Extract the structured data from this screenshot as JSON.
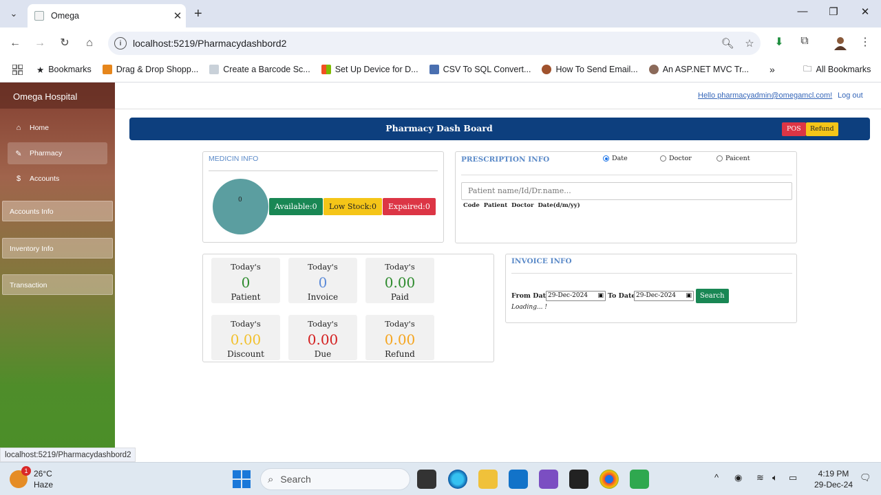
{
  "browser": {
    "tab_title": "Omega",
    "url": "localhost:5219/Pharmacydashbord2",
    "bookmarks_label": "Bookmarks",
    "bookmarks": [
      "Drag & Drop Shopp...",
      "Create a Barcode Sc...",
      "Set Up Device for D...",
      "CSV To SQL Convert...",
      "How To Send Email...",
      "An ASP.NET MVC Tr..."
    ],
    "all_bookmarks": "All Bookmarks",
    "status_url": "localhost:5219/Pharmacydashbord2"
  },
  "app": {
    "brand": "Omega Hospital",
    "nav": [
      {
        "label": "Home",
        "icon": "home-icon"
      },
      {
        "label": "Pharmacy",
        "icon": "pencil-icon"
      },
      {
        "label": "Accounts",
        "icon": "dollar-icon"
      }
    ],
    "sections": [
      "Accounts Info",
      "Inventory Info",
      "Transaction"
    ],
    "hello": "Hello  pharmacyadmin@omegamcl.com!",
    "logout": "Log out"
  },
  "dashboard": {
    "title": "Pharmacy Dash Board",
    "pos_label": "POS",
    "refund_label": "Refund"
  },
  "medicine": {
    "title": "MEDICIN INFO",
    "pie_value": "0",
    "available": "Available:0",
    "low_stock": "Low Stock:0",
    "expired": "Expaired:0"
  },
  "prescription": {
    "title": "PRESCRIPTION INFO",
    "radios": [
      "Date",
      "Doctor",
      "Paicent"
    ],
    "selected_radio": "Date",
    "placeholder": "Patient name/Id/Dr.name...",
    "columns": [
      "Code",
      "Patient",
      "Doctor",
      "Date(d/m/yy)"
    ]
  },
  "stats": [
    {
      "top": "Today's",
      "value": "0",
      "bottom": "Patient",
      "color": "#2e8b2e"
    },
    {
      "top": "Today's",
      "value": "0",
      "bottom": "Invoice",
      "color": "#5b8ad8"
    },
    {
      "top": "Today's",
      "value": "0.00",
      "bottom": "Paid",
      "color": "#2e8b2e"
    },
    {
      "top": "Today's",
      "value": "0.00",
      "bottom": "Discount",
      "color": "#f2c12e"
    },
    {
      "top": "Today's",
      "value": "0.00",
      "bottom": "Due",
      "color": "#d42020"
    },
    {
      "top": "Today's",
      "value": "0.00",
      "bottom": "Refund",
      "color": "#f5a51f"
    }
  ],
  "invoice": {
    "title": "INVOICE INFO",
    "from_label": "From Date:",
    "from_value": "29-Dec-2024",
    "to_label": "To Date:",
    "to_value": "29-Dec-2024",
    "search_label": "Search",
    "loading": "Loading... !"
  },
  "taskbar": {
    "temp": "26°C",
    "weather": "Haze",
    "weather_badge": "1",
    "search_placeholder": "Search",
    "time": "4:19 PM",
    "date": "29-Dec-24"
  },
  "colors": {
    "header_blue": "#0d3f7e",
    "success": "#198754",
    "warning": "#f5c518",
    "danger": "#dc3545"
  }
}
